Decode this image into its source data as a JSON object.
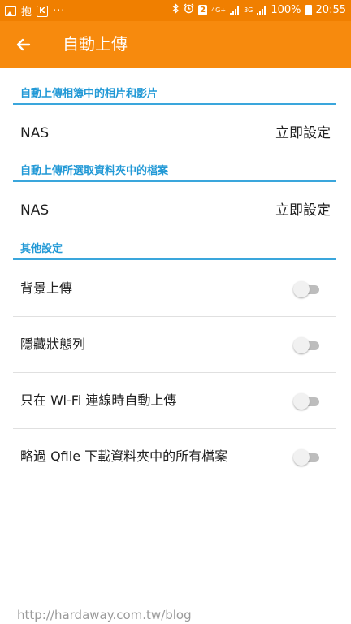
{
  "status_bar": {
    "left_icons": [
      "photo-icon",
      "app-text-icon",
      "k-icon",
      "more-dots-icon"
    ],
    "app_text": "抱",
    "k_text": "K",
    "dots": "···",
    "notification_count": "2",
    "network_4g": "4G+",
    "network_3g": "3G",
    "battery_percent": "100%",
    "time": "20:55"
  },
  "app_bar": {
    "title": "自動上傳",
    "background": "#f78a0d",
    "back_icon": "arrow-left-icon"
  },
  "sections": {
    "photos_videos": {
      "header": "自動上傳相簿中的相片和影片",
      "target": "NAS",
      "action": "立即設定"
    },
    "selected_folders": {
      "header": "自動上傳所選取資料夾中的檔案",
      "target": "NAS",
      "action": "立即設定"
    },
    "other_settings": {
      "header": "其他設定",
      "items": [
        {
          "label": "背景上傳",
          "enabled": false
        },
        {
          "label": "隱藏狀態列",
          "enabled": false
        },
        {
          "label": "只在 Wi-Fi 連線時自動上傳",
          "enabled": false
        },
        {
          "label": "略過 Qfile 下載資料夾中的所有檔案",
          "enabled": false
        }
      ]
    }
  },
  "colors": {
    "accent_blue": "#2299d6",
    "orange": "#f78a0d"
  },
  "watermark": "http://hardaway.com.tw/blog"
}
